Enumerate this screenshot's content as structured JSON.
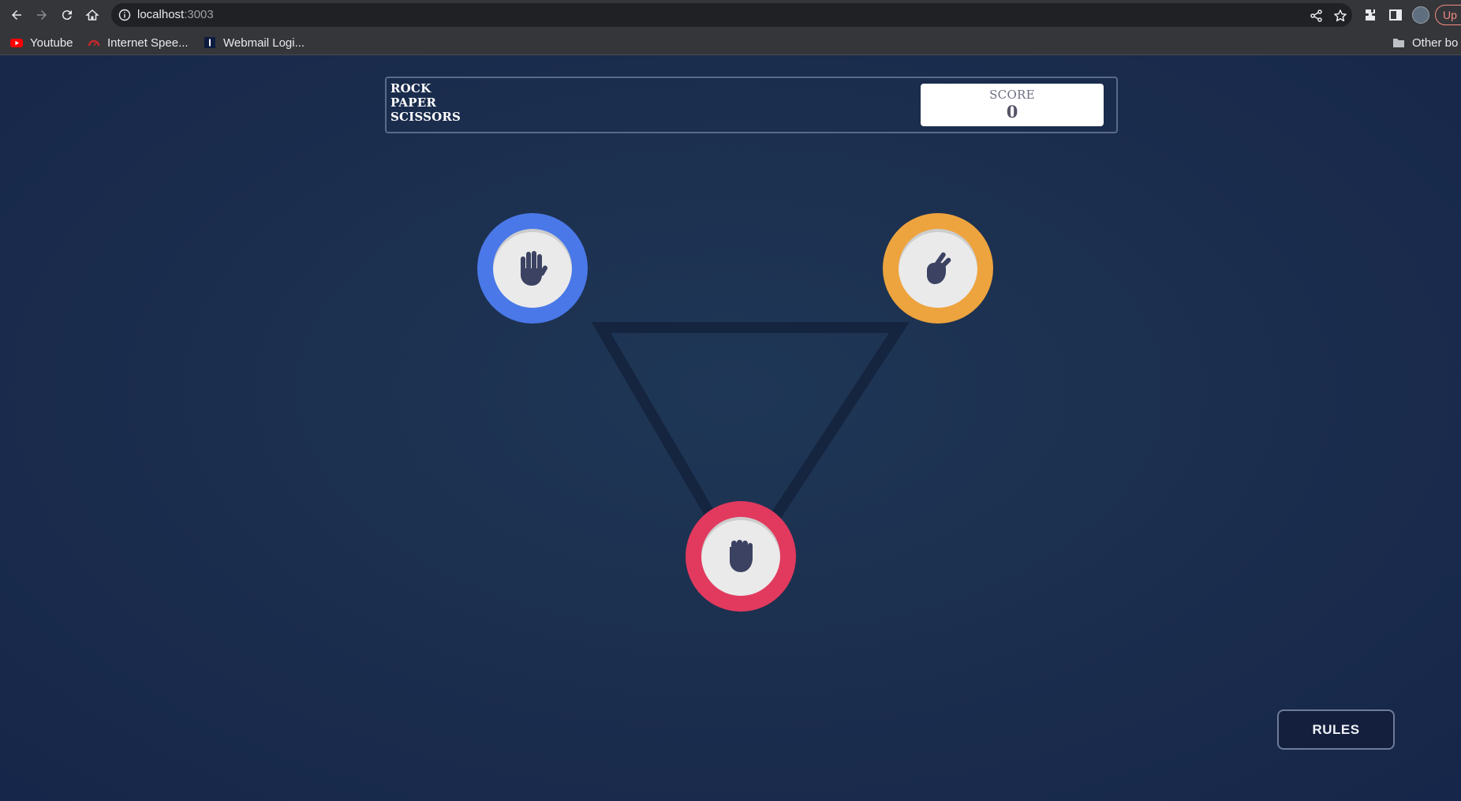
{
  "browser": {
    "url_host": "localhost",
    "url_port": ":3003",
    "bookmarks": [
      {
        "label": "Youtube",
        "icon": "youtube-icon"
      },
      {
        "label": "Internet Spee...",
        "icon": "speedometer-icon"
      },
      {
        "label": "Webmail Logi...",
        "icon": "webmail-icon"
      }
    ],
    "other_bookmarks_label": "Other bo",
    "update_label": "Up"
  },
  "game": {
    "title_lines": [
      "ROCK",
      "PAPER",
      "SCISSORS"
    ],
    "score_label": "SCORE",
    "score_value": "0",
    "choices": [
      {
        "name": "paper",
        "icon": "paper-hand-icon",
        "ring_color": "#4a78e8"
      },
      {
        "name": "scissors",
        "icon": "scissors-hand-icon",
        "ring_color": "#eda33e"
      },
      {
        "name": "rock",
        "icon": "rock-fist-icon",
        "ring_color": "#e23a5e"
      }
    ],
    "rules_label": "RULES"
  },
  "colors": {
    "background": "#1b2d4d",
    "triangle_stroke": "#15243f",
    "icon_color": "#3b4262"
  }
}
